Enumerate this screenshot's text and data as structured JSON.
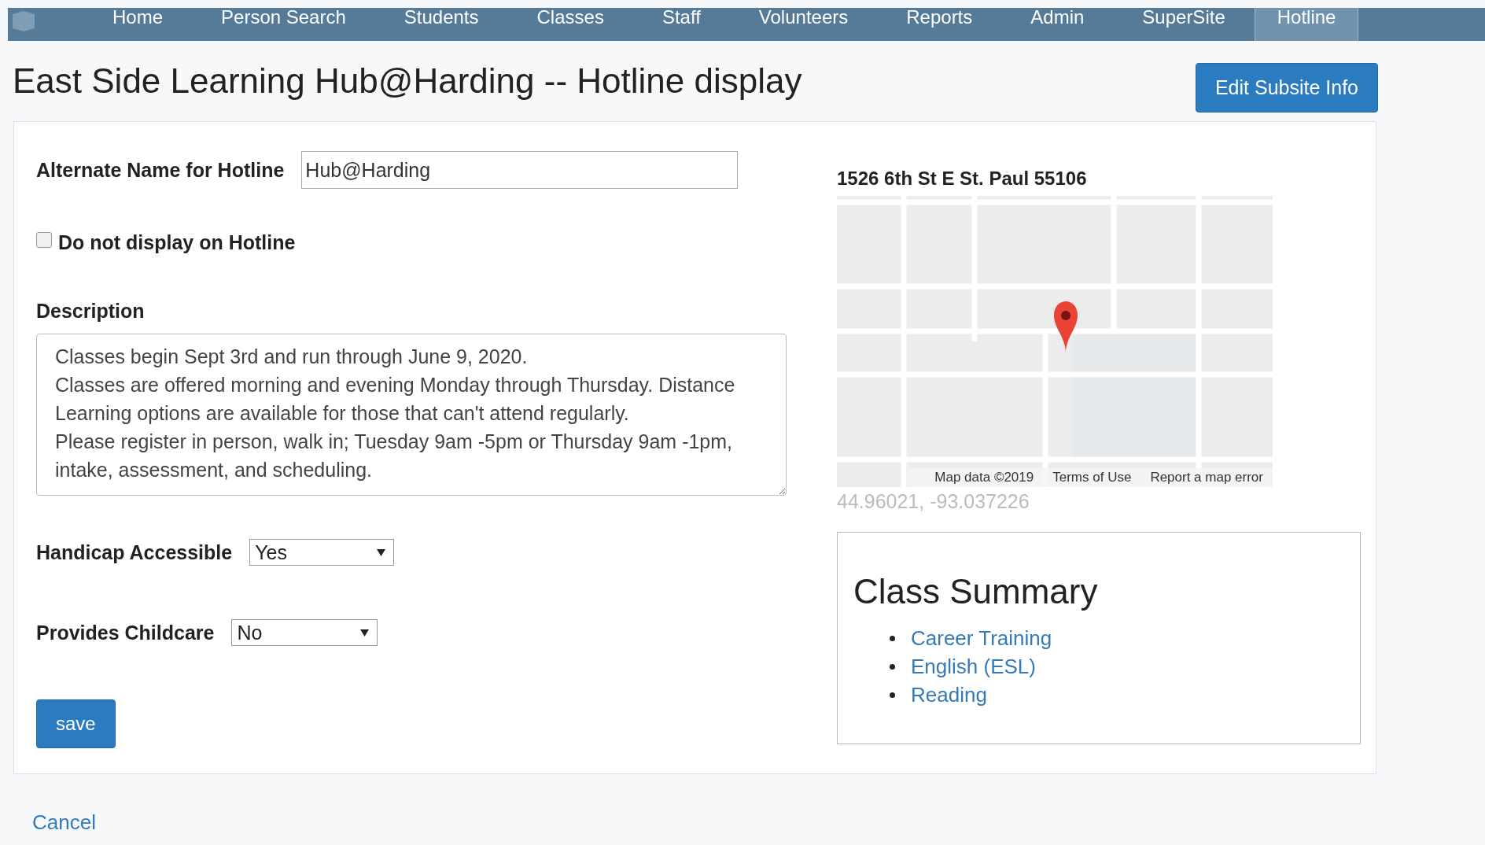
{
  "nav": {
    "items": [
      {
        "label": "Home",
        "selected": false
      },
      {
        "label": "Person Search",
        "selected": false
      },
      {
        "label": "Students",
        "selected": false
      },
      {
        "label": "Classes",
        "selected": false
      },
      {
        "label": "Staff",
        "selected": false
      },
      {
        "label": "Volunteers",
        "selected": false
      },
      {
        "label": "Reports",
        "selected": false
      },
      {
        "label": "Admin",
        "selected": false
      },
      {
        "label": "SuperSite",
        "selected": false
      },
      {
        "label": "Hotline",
        "selected": true
      }
    ]
  },
  "page_title": "East Side Learning Hub@Harding -- Hotline display",
  "edit_button": "Edit Subsite Info",
  "form": {
    "alternate_name": {
      "label": "Alternate Name for Hotline",
      "value": "Hub@Harding"
    },
    "do_not_display": {
      "label": "Do not display on Hotline",
      "checked": false
    },
    "description": {
      "label": "Description",
      "value": "Classes begin Sept 3rd and run through June 9, 2020.\nClasses are offered morning and evening Monday through Thursday. Distance Learning options are available for those that can't attend regularly.\nPlease register in person, walk in; Tuesday 9am -5pm or Thursday 9am -1pm, intake, assessment, and scheduling."
    },
    "handicap_accessible": {
      "label": "Handicap Accessible",
      "value": "Yes"
    },
    "provides_childcare": {
      "label": "Provides Childcare",
      "value": "No"
    },
    "save_button": "save"
  },
  "location": {
    "address": "1526 6th St E St. Paul 55106",
    "map_attribution": [
      "Map data ©2019",
      "Terms of Use",
      "Report a map error"
    ],
    "coordinates": "44.96021, -93.037226"
  },
  "class_summary": {
    "title": "Class Summary",
    "items": [
      "Career Training",
      "English (ESL)",
      "Reading"
    ]
  },
  "cancel_link": "Cancel"
}
